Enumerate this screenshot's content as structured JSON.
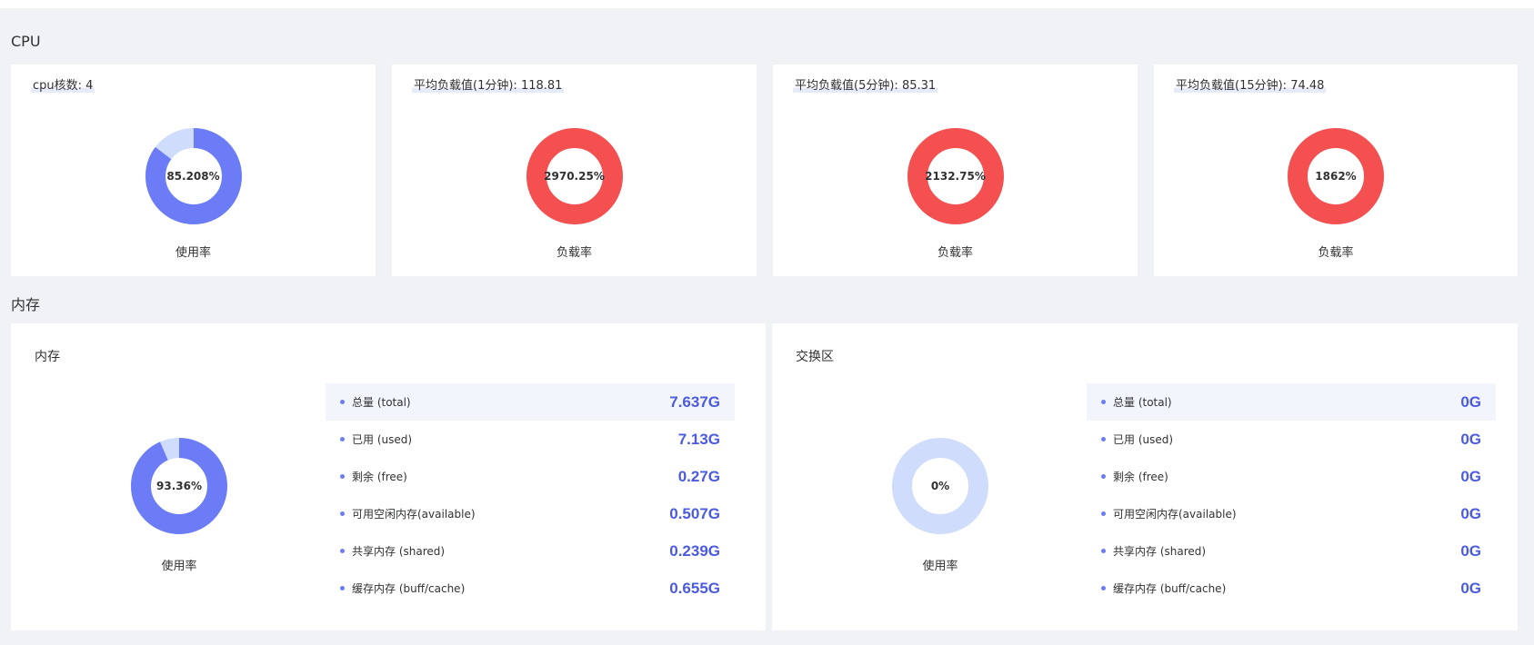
{
  "cpu": {
    "section_title": "CPU",
    "cards": [
      {
        "header_label": "cpu核数:",
        "header_value": "4",
        "percent_text": "85.208%",
        "fraction": 0.85208,
        "ring_color": "#6b7cf6",
        "track_color": "#d0dcfb",
        "caption": "使用率"
      },
      {
        "header_label": "平均负载值(1分钟):",
        "header_value": "118.81",
        "percent_text": "2970.25%",
        "fraction": 1,
        "ring_color": "#f45050",
        "track_color": "#d0dcfb",
        "caption": "负载率"
      },
      {
        "header_label": "平均负载值(5分钟):",
        "header_value": "85.31",
        "percent_text": "2132.75%",
        "fraction": 1,
        "ring_color": "#f45050",
        "track_color": "#d0dcfb",
        "caption": "负载率"
      },
      {
        "header_label": "平均负载值(15分钟):",
        "header_value": "74.48",
        "percent_text": "1862%",
        "fraction": 1,
        "ring_color": "#f45050",
        "track_color": "#d0dcfb",
        "caption": "负载率"
      }
    ]
  },
  "memory": {
    "section_title": "内存",
    "cards": [
      {
        "title": "内存",
        "percent_text": "93.36%",
        "fraction": 0.9336,
        "ring_color": "#6b7cf6",
        "track_color": "#d0dcfb",
        "caption": "使用率",
        "rows": [
          {
            "key": "总量 (total)",
            "value": "7.637G"
          },
          {
            "key": "已用 (used)",
            "value": "7.13G"
          },
          {
            "key": "剩余 (free)",
            "value": "0.27G"
          },
          {
            "key": "可用空闲内存(available)",
            "value": "0.507G"
          },
          {
            "key": "共享内存 (shared)",
            "value": "0.239G"
          },
          {
            "key": "缓存内存 (buff/cache)",
            "value": "0.655G"
          }
        ]
      },
      {
        "title": "交换区",
        "percent_text": "0%",
        "fraction": 0,
        "ring_color": "#6b7cf6",
        "track_color": "#d0dcfb",
        "caption": "使用率",
        "rows": [
          {
            "key": "总量 (total)",
            "value": "0G"
          },
          {
            "key": "已用 (used)",
            "value": "0G"
          },
          {
            "key": "剩余 (free)",
            "value": "0G"
          },
          {
            "key": "可用空闲内存(available)",
            "value": "0G"
          },
          {
            "key": "共享内存 (shared)",
            "value": "0G"
          },
          {
            "key": "缓存内存 (buff/cache)",
            "value": "0G"
          }
        ]
      }
    ]
  }
}
